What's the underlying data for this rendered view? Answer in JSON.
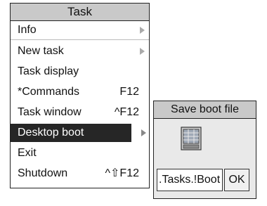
{
  "menu": {
    "title": "Task",
    "items": [
      {
        "label": "Info",
        "shortcut": "",
        "submenu": true,
        "highlighted": false
      },
      {
        "label": "New task",
        "shortcut": "",
        "submenu": true,
        "highlighted": false
      },
      {
        "label": "Task display",
        "shortcut": "",
        "submenu": false,
        "highlighted": false
      },
      {
        "label": "*Commands",
        "shortcut": "F12",
        "submenu": false,
        "highlighted": false
      },
      {
        "label": "Task window",
        "shortcut": "^F12",
        "submenu": false,
        "highlighted": false
      },
      {
        "label": "Desktop boot",
        "shortcut": "",
        "submenu": true,
        "highlighted": true
      },
      {
        "label": "Exit",
        "shortcut": "",
        "submenu": false,
        "highlighted": false
      },
      {
        "label": "Shutdown",
        "shortcut": "^⇧F12",
        "submenu": false,
        "highlighted": false
      }
    ]
  },
  "dialog": {
    "title": "Save boot file",
    "icon": "boot-file-icon",
    "path_value": ".Tasks.!Boot",
    "ok_label": "OK"
  }
}
